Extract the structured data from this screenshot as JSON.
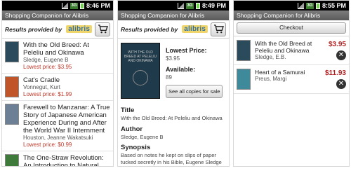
{
  "screens": [
    {
      "time": "8:46 PM",
      "app_title": "Shopping Companion for Alibris",
      "results_label": "Results provided by",
      "logo": "alibris",
      "books": [
        {
          "title": "With the Old Breed: At Peleliu and Okinawa",
          "author": "Sledge, Eugene B",
          "price": "Lowest price: $3.95",
          "cover_color": "#2b4a5c"
        },
        {
          "title": "Cat's Cradle",
          "author": "Vonnegut, Kurt",
          "price": "Lowest price: $1.99",
          "cover_color": "#c0552a"
        },
        {
          "title": "Farewell to Manzanar: A True Story of Japanese American Experience During and After the World War II Internment",
          "author": "Houston, Jeanne Wakatsuki",
          "price": "Lowest price: $0.99",
          "cover_color": "#6c7f94"
        },
        {
          "title": "The One-Straw Revolution: An Introduction to Natural Farming",
          "author": "",
          "price": "",
          "cover_color": "#3e7a3a"
        }
      ]
    },
    {
      "time": "8:49 PM",
      "app_title": "Shopping Companion for Alibris",
      "results_label": "Results provided by",
      "logo": "alibris",
      "cover_text": "WITH THE OLD BREED AT PELELIU AND OKINAWA",
      "lowest_price_label": "Lowest Price:",
      "lowest_price": "$3.95",
      "available_label": "Available:",
      "available": "89",
      "see_all": "See all copies for sale",
      "title_h": "Title",
      "title_v": "With the Old Breed: At Peleliu and Okinawa",
      "author_h": "Author",
      "author_v": "Sledge, Eugene B",
      "synopsis_h": "Synopsis",
      "synopsis_v": "Based on notes he kept on slips of paper tucked secretly in his Bible, Eugene Sledge has written a devastatingly powerful memoir of his"
    },
    {
      "time": "8:55 PM",
      "app_title": "Shopping Companion for Alibris",
      "checkout": "Checkout",
      "items": [
        {
          "title": "With the Old Breed at Peleliu and Okinawa",
          "author": "Sledge, E.B.",
          "price": "$3.95",
          "cover_color": "#2b4a5c"
        },
        {
          "title": "Heart of a Samurai",
          "author": "Preus, Margi",
          "price": "$11.93",
          "cover_color": "#3e8a9a"
        }
      ]
    }
  ]
}
